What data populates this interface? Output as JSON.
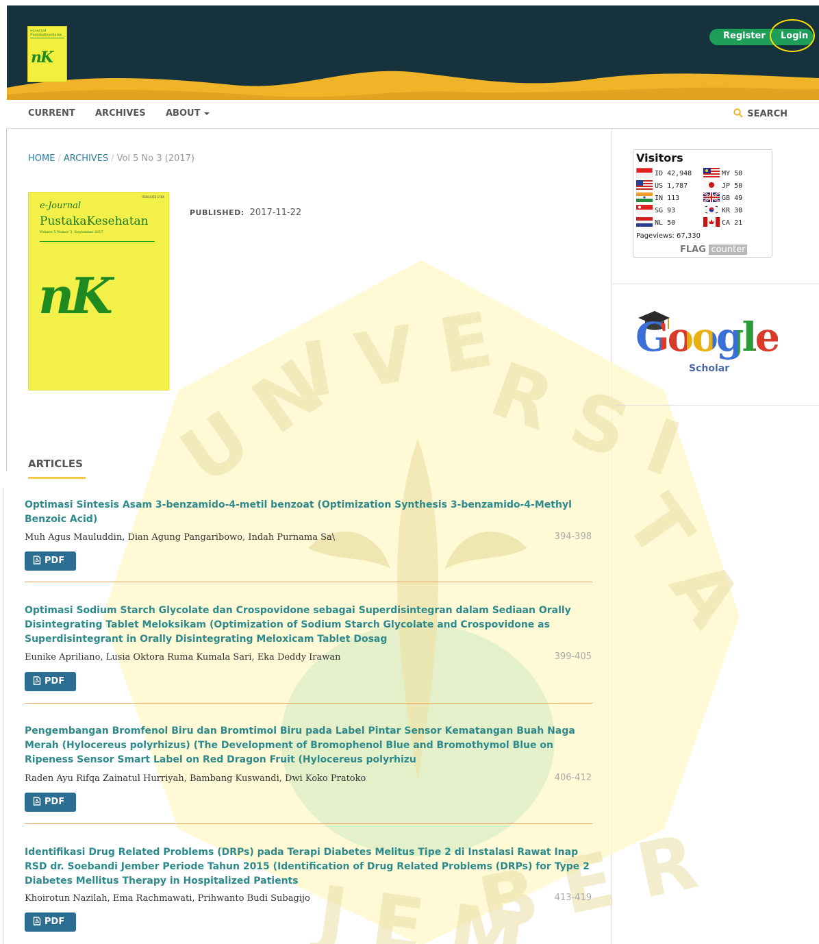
{
  "header": {
    "logo_line1": "e-Journal",
    "logo_line2": "PustakaKesehatan",
    "logo_mono": "nK",
    "register_label": "Register",
    "login_label": "Login"
  },
  "nav": {
    "items": [
      {
        "label": "CURRENT"
      },
      {
        "label": "ARCHIVES"
      },
      {
        "label": "ABOUT"
      }
    ],
    "search_label": "SEARCH"
  },
  "breadcrumb": {
    "home": "HOME",
    "archives": "ARCHIVES",
    "current": "Vol 5 No 3 (2017)"
  },
  "issue": {
    "cover": {
      "issn": "ISSN 2355-178X",
      "journal_line1": "e-Journal",
      "journal_line2": "PustakaKesehatan",
      "volume": "Volume 5 Nomor 3, September 2017",
      "monogram": "nK"
    },
    "published_label": "PUBLISHED:",
    "published_date": "2017-11-22"
  },
  "sidebar": {
    "visitors_title": "Visitors",
    "visitors": [
      {
        "code": "ID",
        "count": "42,948"
      },
      {
        "code": "US",
        "count": "1,787"
      },
      {
        "code": "IN",
        "count": "113"
      },
      {
        "code": "SG",
        "count": "93"
      },
      {
        "code": "NL",
        "count": "50"
      },
      {
        "code": "MY",
        "count": "50"
      },
      {
        "code": "JP",
        "count": "50"
      },
      {
        "code": "GB",
        "count": "49"
      },
      {
        "code": "KR",
        "count": "38"
      },
      {
        "code": "CA",
        "count": "21"
      }
    ],
    "pageviews_label": "Pageviews:",
    "pageviews_value": "67,330",
    "flagcounter_flag": "FLAG",
    "flagcounter_counter": "counter",
    "scholar_google": "Google",
    "scholar_label": "Scholar"
  },
  "articles": {
    "heading": "ARTICLES",
    "items": [
      {
        "title": "Optimasi Sintesis Asam 3-benzamido-4-metil benzoat (Optimization Synthesis 3-benzamido-4-Methyl Benzoic Acid)",
        "authors": "Muh Agus Mauluddin, Dian Agung Pangaribowo, Indah Purnama Sa\\",
        "pages": "394-398",
        "pdf_label": "PDF"
      },
      {
        "title": "Optimasi Sodium Starch Glycolate dan Crospovidone sebagai Superdisintegran dalam Sediaan Orally Disintegrating Tablet Meloksikam (Optimization of Sodium Starch Glycolate and Crospovidone as Superdisintegrant in Orally Disintegrating Meloxicam Tablet Dosag",
        "authors": "Eunike Apriliano, Lusia Oktora Ruma Kumala Sari, Eka Deddy Irawan",
        "pages": "399-405",
        "pdf_label": "PDF"
      },
      {
        "title": "Pengembangan Bromfenol Biru dan Bromtimol Biru pada Label Pintar Sensor Kematangan Buah Naga Merah (Hylocereus polyrhizus) (The Development of Bromophenol Blue and Bromothymol Blue on Ripeness Sensor Smart Label on Red Dragon Fruit (Hylocereus polyrhizu",
        "authors": "Raden Ayu Rifqa Zainatul Hurriyah, Bambang Kuswandi, Dwi Koko Pratoko",
        "pages": "406-412",
        "pdf_label": "PDF"
      },
      {
        "title": "Identifikasi Drug Related Problems (DRPs) pada Terapi Diabetes Melitus Tipe 2 di Instalasi Rawat Inap RSD dr. Soebandi Jember Periode Tahun 2015 (Identification of Drug Related Problems (DRPs) for Type 2 Diabetes Mellitus Therapy in Hospitalized Patients",
        "authors": "Khoirotun Nazilah, Ema Rachmawati, Prihwanto Budi Subagijo",
        "pages": "413-419",
        "pdf_label": "PDF"
      }
    ]
  },
  "watermark_text": "UNIVERSITAS JEMBER",
  "colors": {
    "header_bg": "#15323d",
    "wave_gold": "#f0b429",
    "auth_green": "#1f9e5a",
    "title_teal": "#2d8a8c",
    "pdf_blue": "#2c6e92",
    "separator_orange": "#e8a15a"
  }
}
